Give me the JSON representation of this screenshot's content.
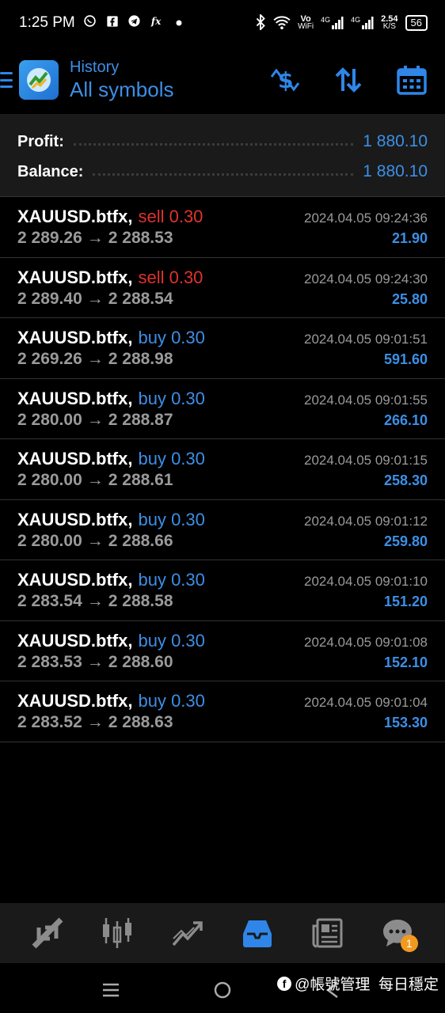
{
  "status_bar": {
    "time": "1:25 PM",
    "vowifi_top": "Vo",
    "vowifi_bottom": "WiFi",
    "sig1": "4G",
    "sig2": "4G",
    "speed_value": "2.54",
    "speed_unit": "K/S",
    "battery": "56"
  },
  "header": {
    "subtitle": "History",
    "title": "All symbols",
    "accent_color": "#3c8fe6"
  },
  "summary": {
    "profit_label": "Profit:",
    "profit_value": "1 880.10",
    "balance_label": "Balance:",
    "balance_value": "1 880.10"
  },
  "deals": [
    {
      "symbol": "XAUUSD.btfx,",
      "type": "sell",
      "volume": "0.30",
      "open": "2 289.26",
      "close": "2 288.53",
      "time": "2024.04.05 09:24:36",
      "profit": "21.90"
    },
    {
      "symbol": "XAUUSD.btfx,",
      "type": "sell",
      "volume": "0.30",
      "open": "2 289.40",
      "close": "2 288.54",
      "time": "2024.04.05 09:24:30",
      "profit": "25.80"
    },
    {
      "symbol": "XAUUSD.btfx,",
      "type": "buy",
      "volume": "0.30",
      "open": "2 269.26",
      "close": "2 288.98",
      "time": "2024.04.05 09:01:51",
      "profit": "591.60"
    },
    {
      "symbol": "XAUUSD.btfx,",
      "type": "buy",
      "volume": "0.30",
      "open": "2 280.00",
      "close": "2 288.87",
      "time": "2024.04.05 09:01:55",
      "profit": "266.10"
    },
    {
      "symbol": "XAUUSD.btfx,",
      "type": "buy",
      "volume": "0.30",
      "open": "2 280.00",
      "close": "2 288.61",
      "time": "2024.04.05 09:01:15",
      "profit": "258.30"
    },
    {
      "symbol": "XAUUSD.btfx,",
      "type": "buy",
      "volume": "0.30",
      "open": "2 280.00",
      "close": "2 288.66",
      "time": "2024.04.05 09:01:12",
      "profit": "259.80"
    },
    {
      "symbol": "XAUUSD.btfx,",
      "type": "buy",
      "volume": "0.30",
      "open": "2 283.54",
      "close": "2 288.58",
      "time": "2024.04.05 09:01:10",
      "profit": "151.20"
    },
    {
      "symbol": "XAUUSD.btfx,",
      "type": "buy",
      "volume": "0.30",
      "open": "2 283.53",
      "close": "2 288.60",
      "time": "2024.04.05 09:01:08",
      "profit": "152.10"
    },
    {
      "symbol": "XAUUSD.btfx,",
      "type": "buy",
      "volume": "0.30",
      "open": "2 283.52",
      "close": "2 288.63",
      "time": "2024.04.05 09:01:04",
      "profit": "153.30"
    }
  ],
  "deal_arrow": "→",
  "bottom_nav": {
    "items": [
      "quotes-icon",
      "chart-icon",
      "trade-icon",
      "history-icon",
      "news-icon",
      "messages-icon"
    ],
    "active": "history-icon",
    "messages_badge": "1"
  },
  "watermark": {
    "fb": "f",
    "text": "@帳號管理  每日穩定"
  }
}
